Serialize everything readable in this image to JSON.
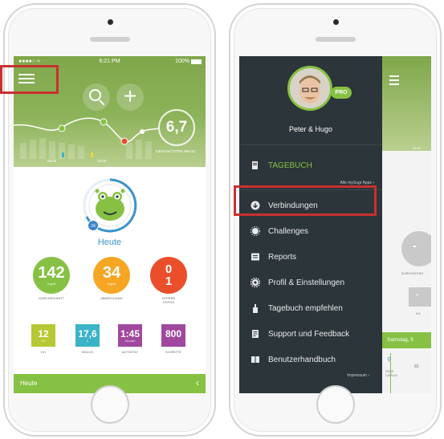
{
  "left_screen": {
    "status": {
      "carrier": "●●●●○ ≈",
      "time": "6:21 PM",
      "battery": "100%"
    },
    "menu_icon": "hamburger-icon",
    "search_icon": "search-icon",
    "add_icon": "plus-icon",
    "hba1c": {
      "value": "6,7",
      "label": "GESCHÄTZTER HBA1C"
    },
    "chart_ticks": [
      "06:00",
      "12:00",
      "18:00"
    ],
    "mascot_badge": "24",
    "today_label": "Heute",
    "stats": [
      {
        "value": "142",
        "unit": "mg/dl",
        "label": "DURCHSCHNITT",
        "color": "#86c143"
      },
      {
        "value": "34",
        "unit": "mg/dl",
        "label": "ABWEICHUNG",
        "color": "#f6a623"
      },
      {
        "value_top": "0",
        "value_bottom": "1",
        "label": "HYPERS\nHYPOS",
        "color": "#e94f2a"
      }
    ],
    "tiles": [
      {
        "value": "12",
        "unit": "KH",
        "label": "KH",
        "color": "#b6c934"
      },
      {
        "value": "17,6",
        "unit": "E",
        "label": "BOLUS",
        "color": "#3ab3c7"
      },
      {
        "value": "1:45",
        "unit": "Stunden",
        "label": "AKTIVITÄT",
        "color": "#a0489e"
      },
      {
        "value": "800",
        "unit": "",
        "label": "SCHRITTE",
        "color": "#a0489e"
      }
    ],
    "footer": {
      "label": "Heute",
      "chevron": "‹"
    }
  },
  "right_screen": {
    "user_name": "Peter & Hugo",
    "pro_badge": "PRO",
    "all_apps": "Alle mySugr Apps ‹",
    "nav": [
      {
        "label": "TAGEBUCH",
        "icon": "logbook-icon"
      },
      {
        "label": "Verbindungen",
        "icon": "download-icon"
      },
      {
        "label": "Challenges",
        "icon": "challenges-icon"
      },
      {
        "label": "Reports",
        "icon": "reports-icon"
      },
      {
        "label": "Profil & Einstellungen",
        "icon": "gear-icon"
      },
      {
        "label": "Tagebuch empfehlen",
        "icon": "recommend-icon"
      },
      {
        "label": "Support und Feedback",
        "icon": "support-icon"
      },
      {
        "label": "Benutzerhandbuch",
        "icon": "book-icon"
      }
    ],
    "impressum": "Impressum ›",
    "behind": {
      "time": "06:00",
      "circle_value": "-",
      "circle_label": "DURCHSCHNI",
      "tile_value": "-",
      "tile_label": "KH",
      "date_bar": "Samstag, 5",
      "lane_text": "25/40\nCAPUCI",
      "num": "83"
    }
  },
  "colors": {
    "accent_green": "#86c143",
    "highlight_red": "#c8302f",
    "drawer_bg": "#2c3539",
    "today_blue": "#3b93cf"
  }
}
